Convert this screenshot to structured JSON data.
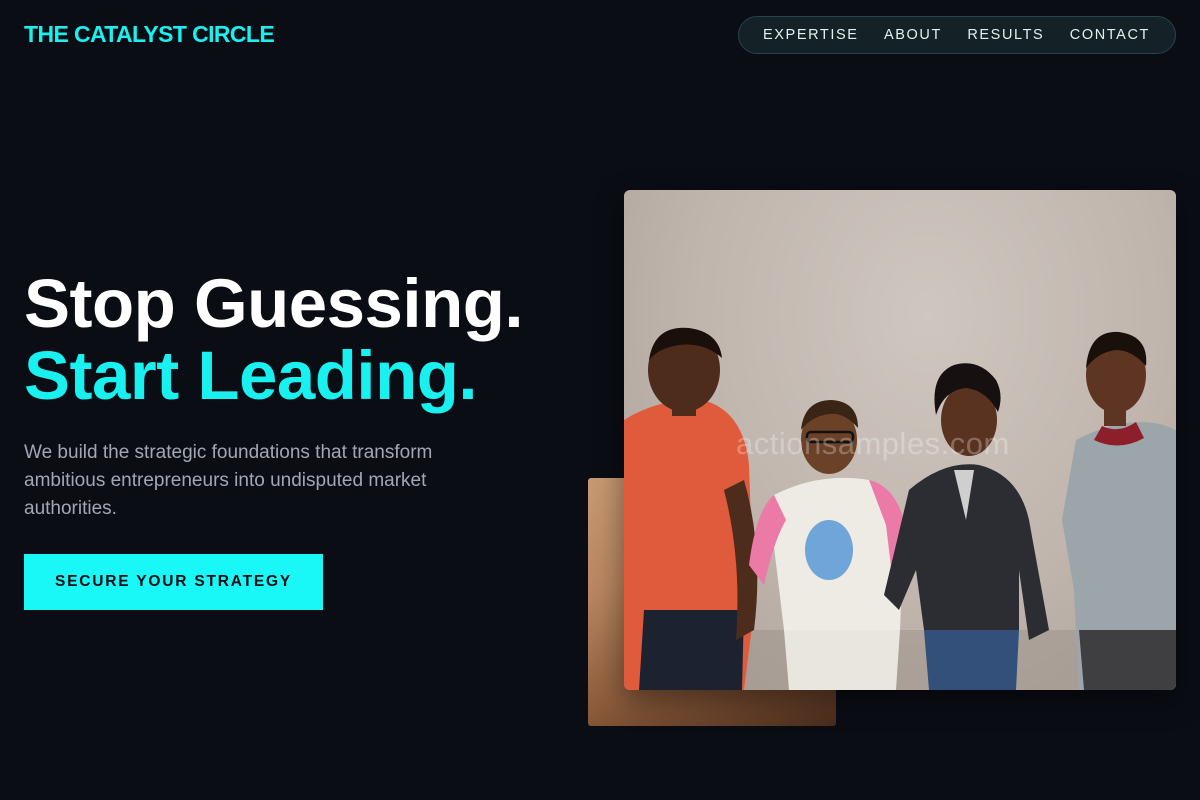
{
  "brand": {
    "name": "THE CATALYST CIRCLE",
    "color": "#19f0f0"
  },
  "nav": {
    "items": [
      {
        "label": "EXPERTISE"
      },
      {
        "label": "ABOUT"
      },
      {
        "label": "RESULTS"
      },
      {
        "label": "CONTACT"
      }
    ]
  },
  "hero": {
    "headline_line1": "Stop Guessing.",
    "headline_line2": "Start Leading.",
    "subtext": "We build the strategic foundations that transform ambitious entrepreneurs into undisputed market authorities.",
    "cta_label": "SECURE YOUR STRATEGY"
  },
  "images": {
    "main_watermark": "actionsamples.com",
    "main_alt": "Group photo of four smiling young people talking in front of a grey wall"
  },
  "colors": {
    "background": "#0a0d14",
    "accent": "#19f0f0",
    "text_primary": "#ffffff",
    "text_secondary": "#a2a8b3"
  }
}
